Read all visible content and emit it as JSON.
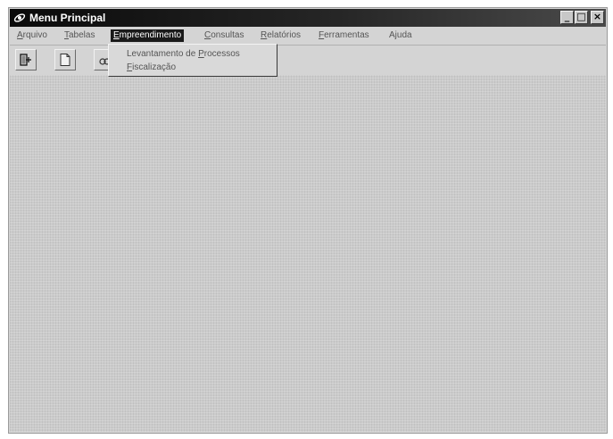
{
  "window": {
    "title": "Menu Principal",
    "controls": {
      "minimize": "_",
      "maximize": "□",
      "close": "×"
    }
  },
  "menubar": {
    "items": [
      {
        "mnemonic": "A",
        "rest": "rquivo"
      },
      {
        "mnemonic": "T",
        "rest": "abelas"
      },
      {
        "mnemonic": "E",
        "rest": "mpreendimento"
      },
      {
        "mnemonic": "C",
        "rest": "onsultas"
      },
      {
        "mnemonic": "R",
        "rest": "elatórios"
      },
      {
        "mnemonic": "F",
        "rest": "erramentas"
      },
      {
        "mnemonic": "",
        "rest": "Ajuda"
      }
    ],
    "active_index": 2
  },
  "dropdown": {
    "items": [
      {
        "before": "Levantamento de ",
        "mnemonic": "P",
        "after": "rocessos"
      },
      {
        "before": "",
        "mnemonic": "F",
        "after": "iscalização"
      }
    ]
  },
  "toolbar": {
    "buttons": [
      {
        "icon": "door-exit-icon"
      },
      {
        "icon": "blank-document-icon"
      },
      {
        "icon": "search-document-icon"
      }
    ]
  },
  "colors": {
    "titlebar": "#0a0a0a",
    "menu_active_bg": "#1a1a1a",
    "window_bg": "#d4d4d4"
  }
}
